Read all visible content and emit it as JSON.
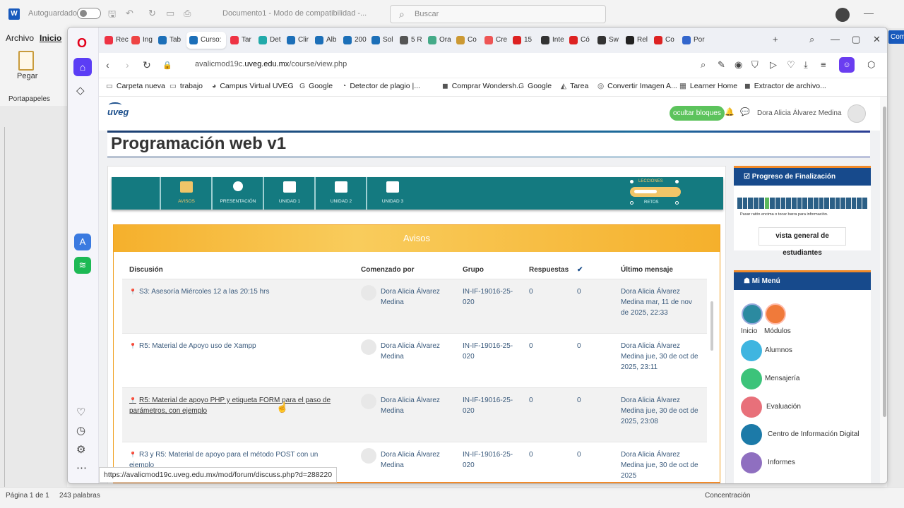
{
  "word": {
    "autosave": "Autoguardado",
    "doc_title": "Documento1 - Modo de compatibilidad -...",
    "search": "Buscar",
    "menu": [
      "Archivo",
      "Inicio"
    ],
    "paste": "Pegar",
    "clipboard": "Portapapeles",
    "comment_btn": "Com",
    "status_page": "Página 1 de 1",
    "status_words": "243 palabras",
    "status_focus": "Concentración"
  },
  "browser": {
    "tabs": [
      "Rec",
      "Ing",
      "Tab",
      "Curso:",
      "Tar",
      "Det",
      "Clir",
      "Alb",
      "200",
      "Sol",
      "5 R",
      "Ora",
      "Co",
      "Cre",
      "15",
      "Inte",
      "Có",
      "Sw",
      "Rel",
      "Co",
      "Por"
    ],
    "url_pre": "avalicmod19c.",
    "url_domain": "uveg.edu.mx",
    "url_path": "/course/view.php",
    "bookmarks": [
      "Carpeta nueva",
      "trabajo",
      "Campus Virtual UVEG",
      "Google",
      "Detector de plagio |...",
      "Comprar Wondersh...",
      "Google",
      "Tarea",
      "Convertir Imagen A...",
      "Learner Home",
      "Extractor de archivo..."
    ],
    "status_url": "https://avalicmod19c.uveg.edu.mx/mod/forum/discuss.php?d=288220"
  },
  "page": {
    "logo": "uveg",
    "hide_blocks": "ocultar bloques",
    "user_name": "Dora Alicia Álvarez Medina",
    "course_title": "Programación web v1",
    "nav": [
      "AVISOS",
      "PRESENTACIÓN",
      "UNIDAD 1",
      "UNIDAD 2",
      "UNIDAD 3"
    ],
    "lecciones": "LECCIONES",
    "retos": "RETOS",
    "avisos_title": "Avisos",
    "table": {
      "headers": [
        "Discusión",
        "Comenzado por",
        "Grupo",
        "Respuestas",
        "✔",
        "Último mensaje"
      ],
      "rows": [
        {
          "disc": "S3: Asesoría Miércoles 12 a las 20:15 hrs",
          "by": "Dora Alicia Álvarez Medina",
          "group": "IN-IF-19016-25-020",
          "resp": "0",
          "check": "0",
          "last": "Dora Alicia Álvarez Medina mar, 11 de nov de 2025, 22:33"
        },
        {
          "disc": "R5: Material de Apoyo uso de Xampp",
          "by": "Dora Alicia Álvarez Medina",
          "group": "IN-IF-19016-25-020",
          "resp": "0",
          "check": "0",
          "last": "Dora Alicia Álvarez Medina jue, 30 de oct de 2025, 23:11"
        },
        {
          "disc": "R5: Material de apoyo PHP y etiqueta FORM para el paso de parámetros, con ejemplo",
          "by": "Dora Alicia Álvarez Medina",
          "group": "IN-IF-19016-25-020",
          "resp": "0",
          "check": "0",
          "last": "Dora Alicia Álvarez Medina jue, 30 de oct de 2025, 23:08"
        },
        {
          "disc": "R3 y R5: Material de apoyo para el método POST con un ejemplo",
          "by": "Dora Alicia Álvarez Medina",
          "group": "IN-IF-19016-25-020",
          "resp": "0",
          "check": "0",
          "last": "Dora Alicia Álvarez Medina jue, 30 de oct de 2025"
        }
      ]
    },
    "progress": {
      "title": "Progreso de Finalización",
      "hint": "Pasar ratón encima o tocar barra para información.",
      "students_btn": "vista general de estudiantes"
    },
    "menu": {
      "title": "Mi Menú",
      "items": [
        "Inicio",
        "Módulos",
        "Alumnos",
        "Mensajería",
        "Evaluación",
        "Centro de Información Digital",
        "Informes"
      ]
    }
  }
}
